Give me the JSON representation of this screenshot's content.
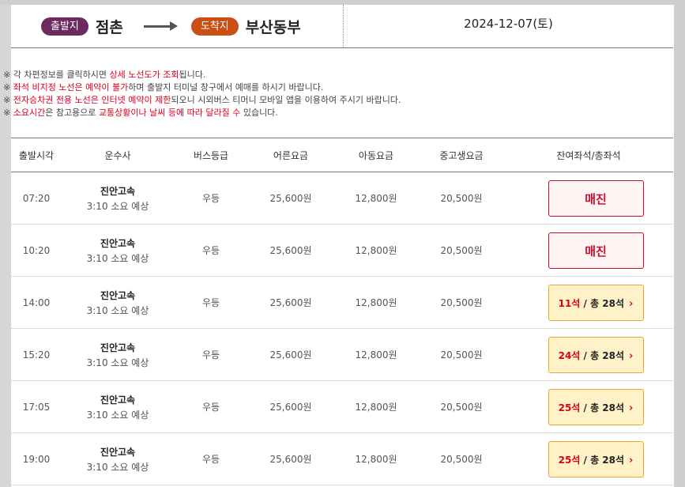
{
  "route": {
    "origin_badge": "출발지",
    "origin_city": "점촌",
    "dest_badge": "도착지",
    "dest_city": "부산동부",
    "date": "2024-12-07(토)"
  },
  "notices": [
    {
      "p1": "※ 각 차편정보를 클릭하시면 ",
      "hl": "상세 노선도가 조회",
      "p2": "됩니다."
    },
    {
      "p1": "※ ",
      "hl": "좌석 비지정 노선은 예약이 불가",
      "p2": "하며 출발지 터미널 창구에서 예매를 하시기 바랍니다."
    },
    {
      "p1": "※ ",
      "hl": "전자승차권 전용 노선은 인터넷 예약이 제한",
      "p2": "되오니 시외버스 티머니 모바일 앱을 이용하여 주시기 바랍니다."
    },
    {
      "p1": "※ ",
      "hl": "소요시간",
      "p2": "은 참고용으로 ",
      "hl2": "교통상황이나 날씨 등에 따라 달라질 수",
      "p3": " 있습니다."
    }
  ],
  "table": {
    "headers": [
      "출발시각",
      "운수사",
      "버스등급",
      "어른요금",
      "아동요금",
      "중고생요금",
      "잔여좌석/총좌석"
    ],
    "rows": [
      {
        "time": "07:20",
        "company": "진안고속",
        "duration": "3:10 소요 예상",
        "grade": "우등",
        "adult": "25,600원",
        "child": "12,800원",
        "student": "20,500원",
        "status": "soldout",
        "status_label": "매진"
      },
      {
        "time": "10:20",
        "company": "진안고속",
        "duration": "3:10 소요 예상",
        "grade": "우등",
        "adult": "25,600원",
        "child": "12,800원",
        "student": "20,500원",
        "status": "soldout",
        "status_label": "매진"
      },
      {
        "time": "14:00",
        "company": "진안고속",
        "duration": "3:10 소요 예상",
        "grade": "우등",
        "adult": "25,600원",
        "child": "12,800원",
        "student": "20,500원",
        "status": "available",
        "avail": "11석",
        "total": " / 총 28석"
      },
      {
        "time": "15:20",
        "company": "진안고속",
        "duration": "3:10 소요 예상",
        "grade": "우등",
        "adult": "25,600원",
        "child": "12,800원",
        "student": "20,500원",
        "status": "available",
        "avail": "24석",
        "total": " / 총 28석"
      },
      {
        "time": "17:05",
        "company": "진안고속",
        "duration": "3:10 소요 예상",
        "grade": "우등",
        "adult": "25,600원",
        "child": "12,800원",
        "student": "20,500원",
        "status": "available",
        "avail": "25석",
        "total": " / 총 28석"
      },
      {
        "time": "19:00",
        "company": "진안고속",
        "duration": "3:10 소요 예상",
        "grade": "우등",
        "adult": "25,600원",
        "child": "12,800원",
        "student": "20,500원",
        "status": "available",
        "avail": "25석",
        "total": " / 총 28석"
      }
    ]
  },
  "icons": {
    "arrow": "right-arrow-icon",
    "chevron": "chevron-right-icon"
  },
  "colors": {
    "origin_badge": "#6c2a5e",
    "dest_badge": "#c94f14",
    "soldout": "#c8102e",
    "available_bg": "#fff1c8",
    "highlight": "#d8001c"
  }
}
